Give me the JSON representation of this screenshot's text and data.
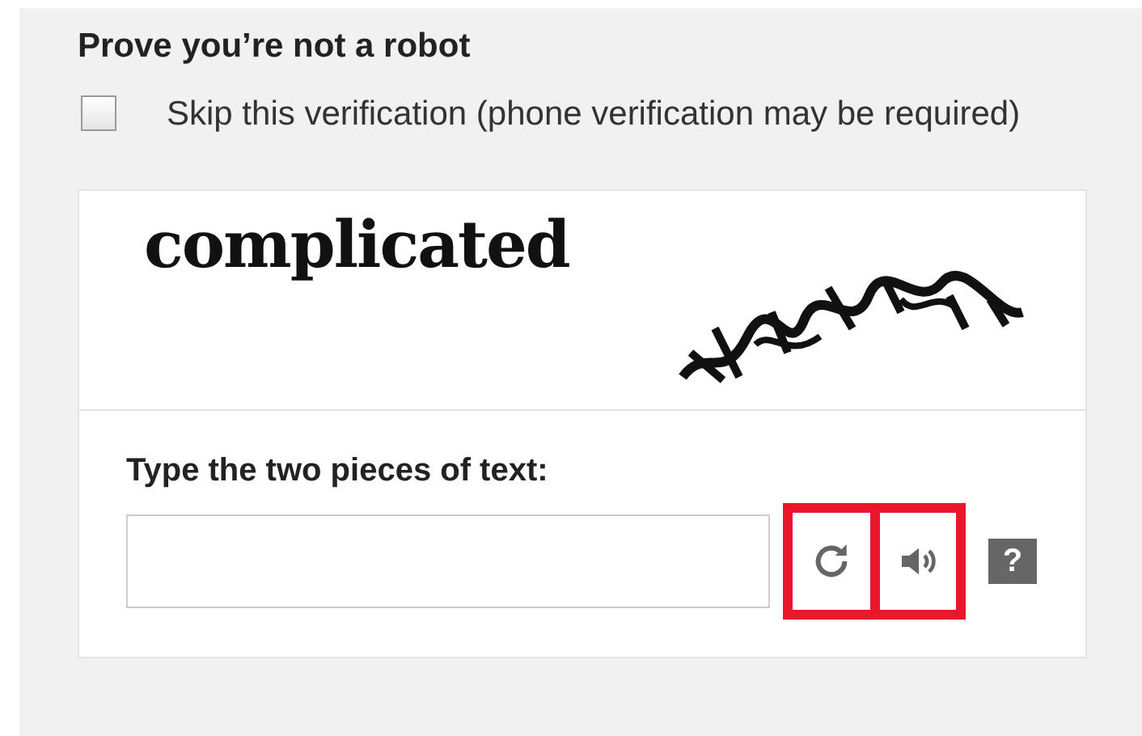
{
  "title": "Prove you’re not a robot",
  "skip": {
    "label": "Skip this verification (phone verification may be required)",
    "checked": false
  },
  "captcha": {
    "word": "complicated"
  },
  "answer": {
    "label": "Type the two pieces of text:"
  },
  "help": {
    "symbol": "?"
  }
}
